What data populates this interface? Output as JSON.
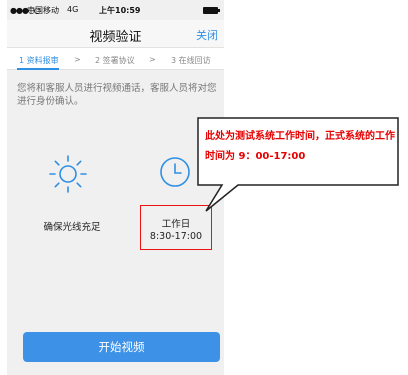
{
  "status_bar": {
    "signal": "●●●○○",
    "carrier": "中国移动",
    "network": "4G",
    "time": "上午10:59"
  },
  "nav": {
    "title": "视频验证",
    "close_label": "关闭"
  },
  "steps": [
    {
      "label": "1 资料报审",
      "active": true
    },
    {
      "label": "2 签署协议",
      "active": false
    },
    {
      "label": "3 在线回访",
      "active": false
    }
  ],
  "step_separator": ">",
  "intro_text": "您将和客服人员进行视频通话，客服人员将对您进行身份确认。",
  "tips": {
    "light_label": "确保光线充足",
    "work_title": "工作日",
    "work_hours": "8:30-17:00"
  },
  "start_button_label": "开始视频",
  "annotation": {
    "text": "此处为测试系统工作时间，正式系统的工作时间为 9：00-17:00",
    "color": "#e60000"
  },
  "colors": {
    "accent": "#2f8fe3",
    "button": "#3d92e8",
    "highlight_border": "#e11111"
  },
  "icons": {
    "sun": "sun-icon",
    "clock": "clock-icon"
  }
}
